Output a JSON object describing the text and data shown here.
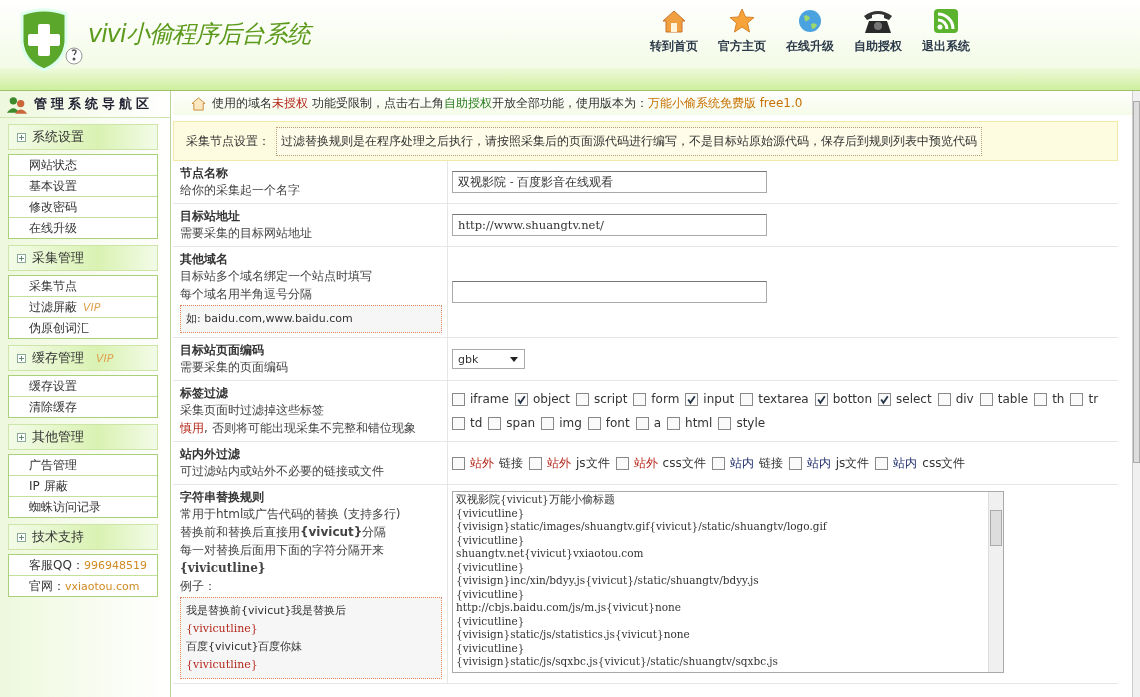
{
  "header": {
    "title": "vivi小偷程序后台系统",
    "nav": [
      {
        "label": "转到首页"
      },
      {
        "label": "官方主页"
      },
      {
        "label": "在线升级"
      },
      {
        "label": "自助授权"
      },
      {
        "label": "退出系统"
      }
    ]
  },
  "sidebar": {
    "title": "管理系统导航区",
    "groups": [
      {
        "title": "系统设置",
        "items": [
          {
            "label": "网站状态"
          },
          {
            "label": "基本设置"
          },
          {
            "label": "修改密码"
          },
          {
            "label": "在线升级"
          }
        ]
      },
      {
        "title": "采集管理",
        "items": [
          {
            "label": "采集节点"
          },
          {
            "label": "过滤屏蔽",
            "badge": "VIP"
          },
          {
            "label": "伪原创词汇"
          }
        ]
      },
      {
        "title": "缓存管理",
        "badge": "VIP",
        "items": [
          {
            "label": "缓存设置"
          },
          {
            "label": "清除缓存"
          }
        ]
      },
      {
        "title": "其他管理",
        "items": [
          {
            "label": "广告管理"
          },
          {
            "label": "IP 屏蔽"
          },
          {
            "label": "蜘蛛访问记录"
          }
        ]
      },
      {
        "title": "技术支持",
        "items": [
          {
            "label": "客服QQ：",
            "value": "996948519"
          },
          {
            "label": "官网：",
            "value": "vxiaotou.com"
          }
        ]
      }
    ]
  },
  "notice": {
    "parts": [
      {
        "text": "使用的域名"
      },
      {
        "text": "未授权",
        "color": "#b5271b"
      },
      {
        "text": " 功能受限制，点击右上角"
      },
      {
        "text": "自助授权",
        "color": "#2a7d1f"
      },
      {
        "text": "开放全部功能，使用版本为："
      },
      {
        "text": "万能小偷系统免费版 free1.0",
        "color": "#c87000"
      }
    ]
  },
  "section": {
    "label": "采集节点设置：",
    "hint": "过滤替换规则是在程序处理之后执行，请按照采集后的页面源代码进行编写，不是目标站原始源代码，保存后到规则列表中预览代码"
  },
  "rows": [
    {
      "title": "节点名称",
      "desc": [
        {
          "text": "给你的采集起一个名字"
        }
      ],
      "kind": "text",
      "value": "双视影院 - 百度影音在线观看"
    },
    {
      "title": "目标站地址",
      "desc": [
        {
          "text": "需要采集的目标网站地址"
        }
      ],
      "kind": "text",
      "value": "http://www.shuangtv.net/"
    },
    {
      "title": "其他域名",
      "desc": [
        {
          "text": "目标站多个域名绑定一个站点时填写"
        },
        {
          "text": "每个域名用半角逗号分隔"
        }
      ],
      "example": [
        {
          "text": "如: baidu.com,www.baidu.com",
          "kind": "plain"
        }
      ],
      "kind": "text-mid"
    },
    {
      "title": "目标站页面编码",
      "desc": [
        {
          "text": "需要采集的页面编码"
        }
      ],
      "kind": "select",
      "value": "gbk"
    },
    {
      "title": "标签过滤",
      "desc": [
        {
          "text": "采集页面时过滤掉这些标签"
        },
        {
          "lead": "慎用",
          "text": ", 否则将可能出现采集不完整和错位现象"
        }
      ],
      "kind": "checks",
      "options": [
        {
          "label": "iframe",
          "checked": false
        },
        {
          "label": "object",
          "checked": true
        },
        {
          "label": "script",
          "checked": false
        },
        {
          "label": "form",
          "checked": false
        },
        {
          "label": "input",
          "checked": true
        },
        {
          "label": "textarea",
          "checked": false
        },
        {
          "label": "botton",
          "checked": true
        },
        {
          "label": "select",
          "checked": true
        },
        {
          "label": "div",
          "checked": false
        },
        {
          "label": "table",
          "checked": false
        },
        {
          "label": "th",
          "checked": false
        },
        {
          "label": "tr",
          "checked": false
        },
        {
          "label": "td",
          "checked": false
        },
        {
          "label": "span",
          "checked": false
        },
        {
          "label": "img",
          "checked": false
        },
        {
          "label": "font",
          "checked": false
        },
        {
          "label": "a",
          "checked": false
        },
        {
          "label": "html",
          "checked": false
        },
        {
          "label": "style",
          "checked": false
        }
      ]
    },
    {
      "title": "站内外过滤",
      "desc": [
        {
          "text": "可过滤站内或站外不必要的链接或文件"
        }
      ],
      "kind": "scope-checks",
      "options": [
        {
          "prefix": "站外",
          "rest": "链接",
          "color": "#b5271b",
          "checked": false
        },
        {
          "prefix": "站外",
          "rest": "js文件",
          "color": "#b5271b",
          "checked": false
        },
        {
          "prefix": "站外",
          "rest": "css文件",
          "color": "#b5271b",
          "checked": false
        },
        {
          "prefix": "站内",
          "rest": "链接",
          "color": "#1d2c6a",
          "checked": false
        },
        {
          "prefix": "站内",
          "rest": "js文件",
          "color": "#1d2c6a",
          "checked": false
        },
        {
          "prefix": "站内",
          "rest": "css文件",
          "color": "#1d2c6a",
          "checked": false
        }
      ]
    },
    {
      "title": "字符串替换规则",
      "desc": [
        {
          "text": "常用于html或广告代码的替换 (支持多行)"
        },
        {
          "text": "替换前和替换后直接用**{vivicut}**分隔"
        },
        {
          "text": "每一对替换后面用下面的字符分隔开来"
        },
        {
          "text": "{vivicutline}",
          "strong": true
        },
        {
          "text": "例子："
        }
      ],
      "example": [
        {
          "text": "我是替换前{vivicut}我是替换后",
          "kind": "plain"
        },
        {
          "text": "{vivicutline}",
          "kind": "separator"
        },
        {
          "text": "百度{vivicut}百度你妹",
          "kind": "plain"
        },
        {
          "text": "{vivicutline}",
          "kind": "separator"
        }
      ],
      "kind": "textarea",
      "lines": [
        "双视影院{vivicut}万能小偷标题",
        "{vivicutline}",
        "{vivisign}static/images/shuangtv.gif{vivicut}/static/shuangtv/logo.gif",
        "{vivicutline}",
        "shuangtv.net{vivicut}vxiaotou.com",
        "{vivicutline}",
        "{vivisign}inc/xin/bdyy.js{vivicut}/static/shuangtv/bdyy.js",
        "{vivicutline}",
        "http://cbjs.baidu.com/js/m.js{vivicut}none",
        "{vivicutline}",
        "{vivisign}static/js/statistics.js{vivicut}none",
        "{vivicutline}",
        "{vivisign}static/js/sqxbc.js{vivicut}/static/shuangtv/sqxbc.js"
      ]
    }
  ]
}
